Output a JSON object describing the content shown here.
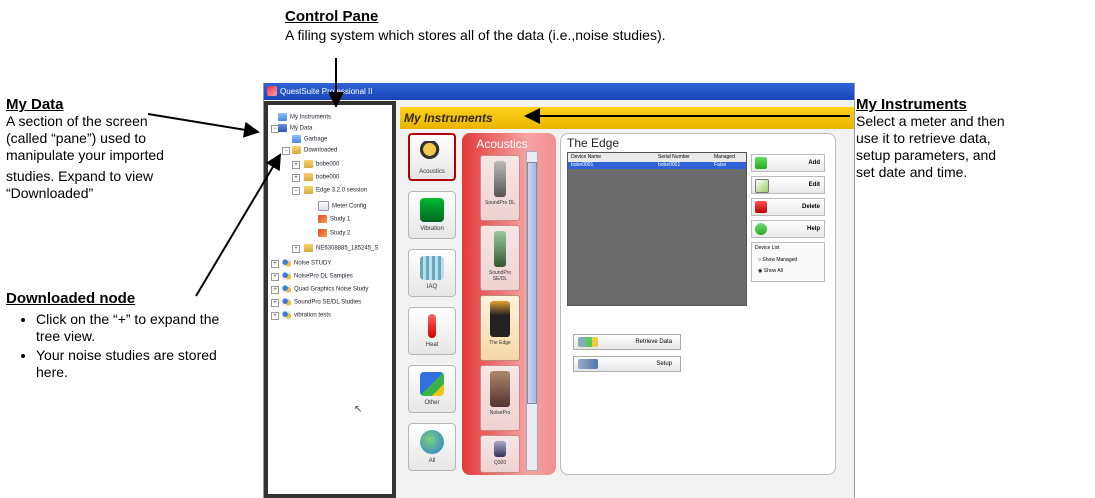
{
  "annotations": {
    "control_pane": {
      "title": "Control Pane",
      "body": "A filing system which stores all of the data (i.e.,noise studies)."
    },
    "my_data": {
      "title": "My Data",
      "lines": [
        "A section of the screen",
        "(called “pane”) used to",
        "manipulate your imported",
        "studies. Expand to view",
        "“Downloaded”"
      ]
    },
    "downloaded_node": {
      "title": "Downloaded node",
      "bullets": [
        "Click on the “+” to expand the tree view.",
        "Your noise studies are stored here."
      ]
    },
    "my_instruments": {
      "title": "My Instruments",
      "lines": [
        "Select a meter and then",
        "use it to retrieve data,",
        "setup parameters, and",
        "set date and time."
      ]
    }
  },
  "app": {
    "window_title": "QuestSuite Professional II",
    "tree": {
      "items": [
        {
          "label": "My Instruments"
        },
        {
          "label": "My Data"
        },
        {
          "label": "Garbage"
        },
        {
          "label": "Downloaded"
        },
        {
          "label": "bobe000"
        },
        {
          "label": "bobe000"
        },
        {
          "label": "Edge 3.2.0 session"
        },
        {
          "label": "Meter Config"
        },
        {
          "label": "Study 1"
        },
        {
          "label": "Study 2"
        },
        {
          "label": "NE6308885_185245_S"
        },
        {
          "label": "Noise STUDY"
        },
        {
          "label": "NoisePro DL Samples"
        },
        {
          "label": "Quad Graphics Noise Study"
        },
        {
          "label": "SoundPro SE/DL Studies"
        },
        {
          "label": "vibration tests"
        }
      ]
    },
    "header": {
      "title": "My Instruments"
    },
    "categories": [
      {
        "label": "Acoustics"
      },
      {
        "label": "Vibration"
      },
      {
        "label": "IAQ"
      },
      {
        "label": "Heat"
      },
      {
        "label": "Other"
      },
      {
        "label": "All"
      }
    ],
    "acoustics": {
      "title": "Acoustics",
      "meters": [
        {
          "label": "SoundPro DL"
        },
        {
          "label": "SoundPro SE/DL"
        },
        {
          "label": "The Edge"
        },
        {
          "label": "NoisePro"
        },
        {
          "label": "Q300"
        }
      ]
    },
    "edge": {
      "title": "The Edge",
      "columns": [
        "Device Name",
        "Serial Number",
        "Managed"
      ],
      "rows": [
        [
          "bobe0001",
          "bobe0001",
          "False"
        ]
      ],
      "buttons": {
        "add": "Add",
        "edit": "Edit",
        "delete": "Delete",
        "help": "Help"
      },
      "device_list": {
        "title": "Device List",
        "options": [
          "Show Managed",
          "Show All"
        ]
      },
      "retrieve_data": "Retrieve Data",
      "setup": "Setup"
    }
  }
}
